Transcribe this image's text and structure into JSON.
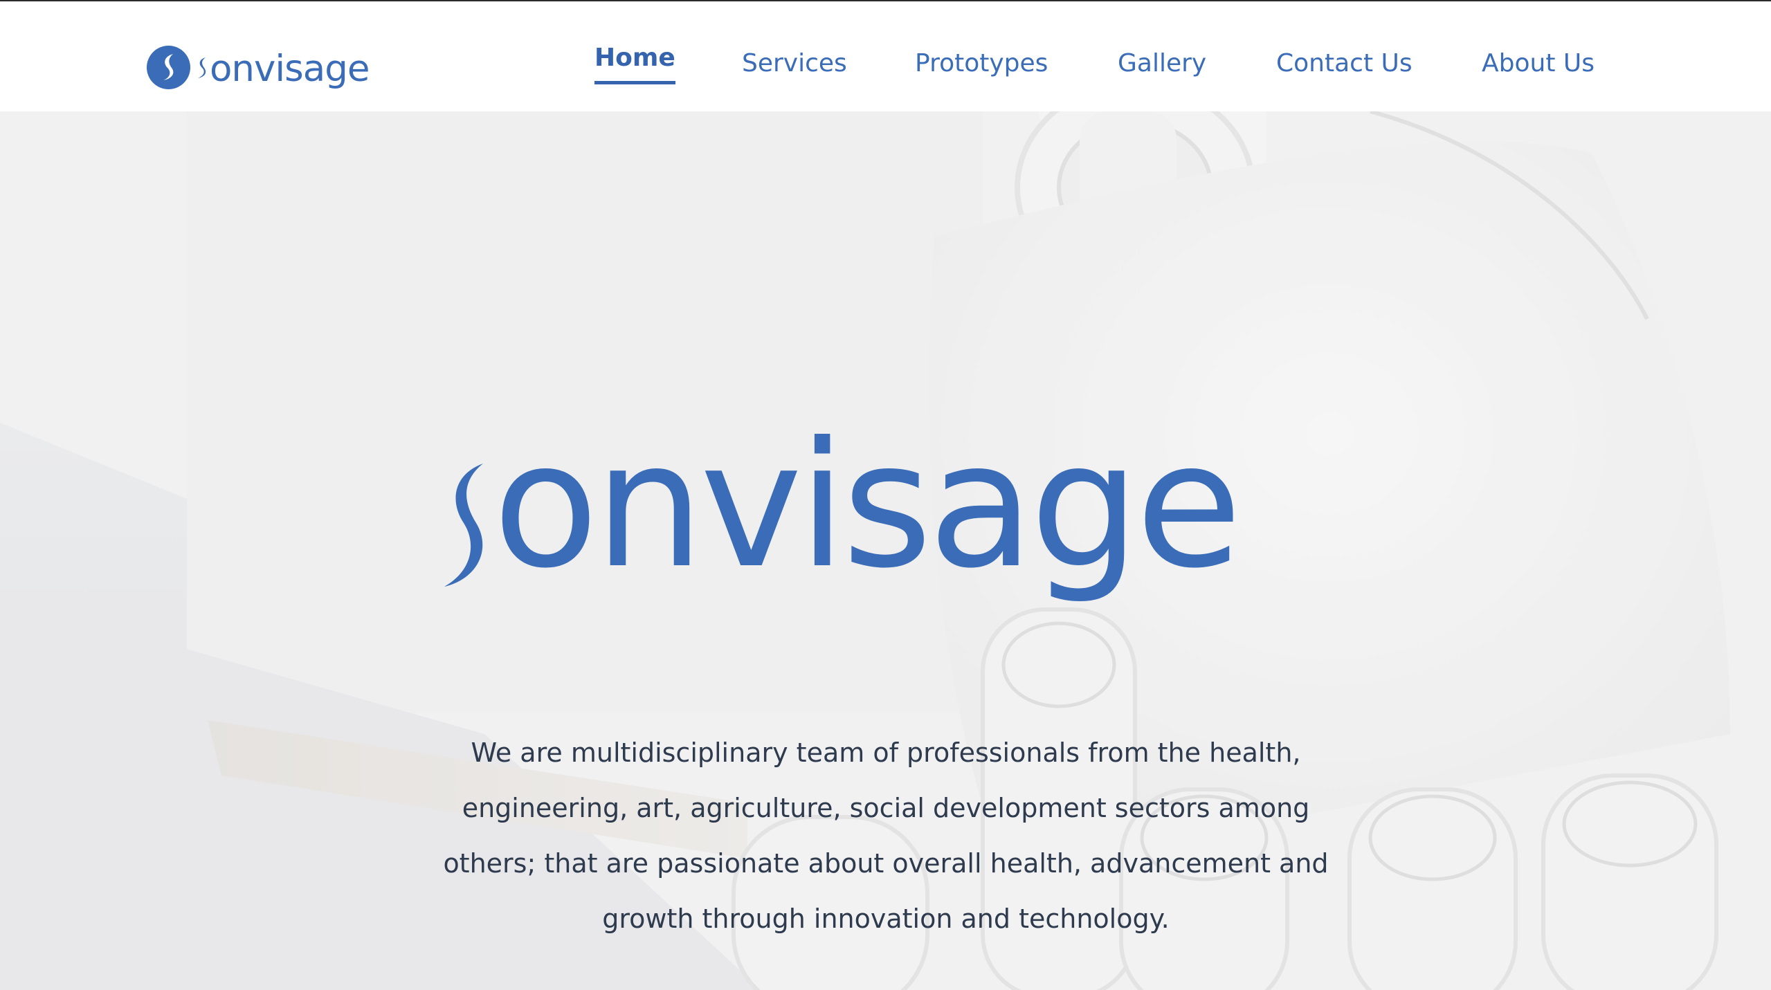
{
  "header": {
    "logo_text": "onvisage",
    "nav": [
      {
        "label": "Home",
        "active": true
      },
      {
        "label": "Services",
        "active": false
      },
      {
        "label": "Prototypes",
        "active": false
      },
      {
        "label": "Gallery",
        "active": false
      },
      {
        "label": "Contact Us",
        "active": false
      },
      {
        "label": "About Us",
        "active": false
      }
    ]
  },
  "hero": {
    "wordmark_text": "onvisage",
    "tagline": "We are multidisciplinary team of professionals from the health, engineering, art, agriculture, social development sectors among others; that are passionate about overall health, advancement and growth through innovation and technology."
  },
  "colors": {
    "brand_blue": "#3a6cb8",
    "body_text": "#2e3a4d",
    "header_bg": "#ffffff"
  }
}
